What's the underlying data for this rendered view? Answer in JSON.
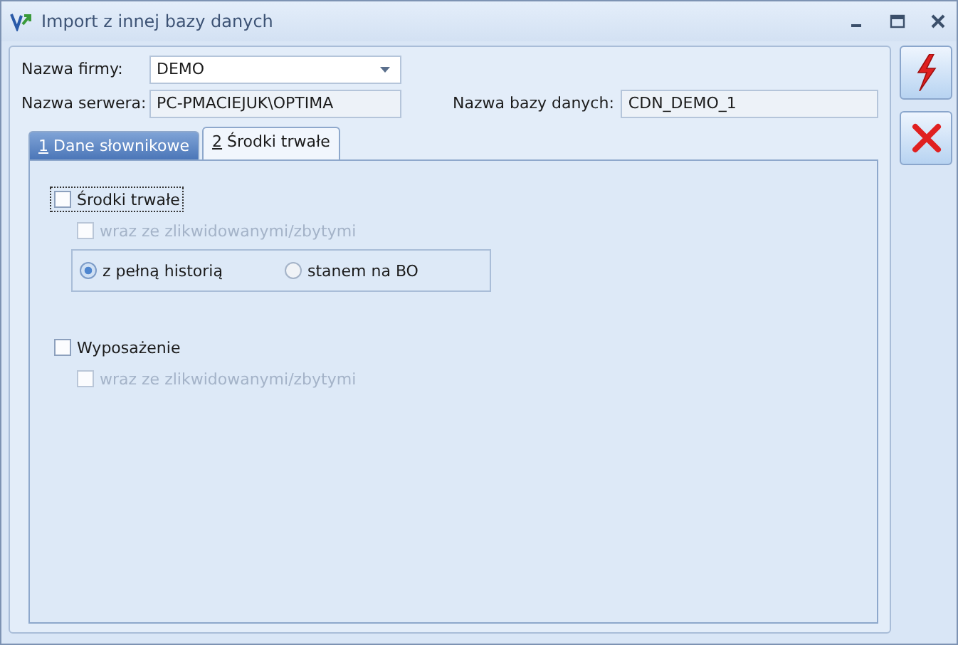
{
  "window": {
    "title": "Import z innej bazy danych"
  },
  "fields": [
    {
      "label": "Nazwa firmy:",
      "value": "DEMO",
      "kind": "combo"
    },
    {
      "label": "Nazwa serwera:",
      "value": "PC-PMACIEJUK\\OPTIMA",
      "kind": "readonly"
    }
  ],
  "database": {
    "label": "Nazwa bazy danych:",
    "value": "CDN_DEMO_1"
  },
  "tabs": [
    {
      "mnemonic": "1",
      "label": "Dane słownikowe",
      "selected": false
    },
    {
      "mnemonic": "2",
      "label": "Środki trwałe",
      "selected": true
    }
  ],
  "groups": [
    {
      "label": "Środki trwałe",
      "checked": false,
      "focused": true,
      "sub": {
        "label": "wraz ze zlikwidowanymi/zbytymi",
        "checked": false,
        "disabled": true
      },
      "radios": [
        {
          "label": "z pełną historią",
          "selected": true
        },
        {
          "label": "stanem na BO",
          "selected": false
        }
      ]
    },
    {
      "label": "Wyposażenie",
      "checked": false,
      "focused": false,
      "sub": {
        "label": "wraz ze zlikwidowanymi/zbytymi",
        "checked": false,
        "disabled": true
      }
    }
  ],
  "actions": [
    {
      "kind": "run"
    },
    {
      "kind": "cancel"
    }
  ]
}
